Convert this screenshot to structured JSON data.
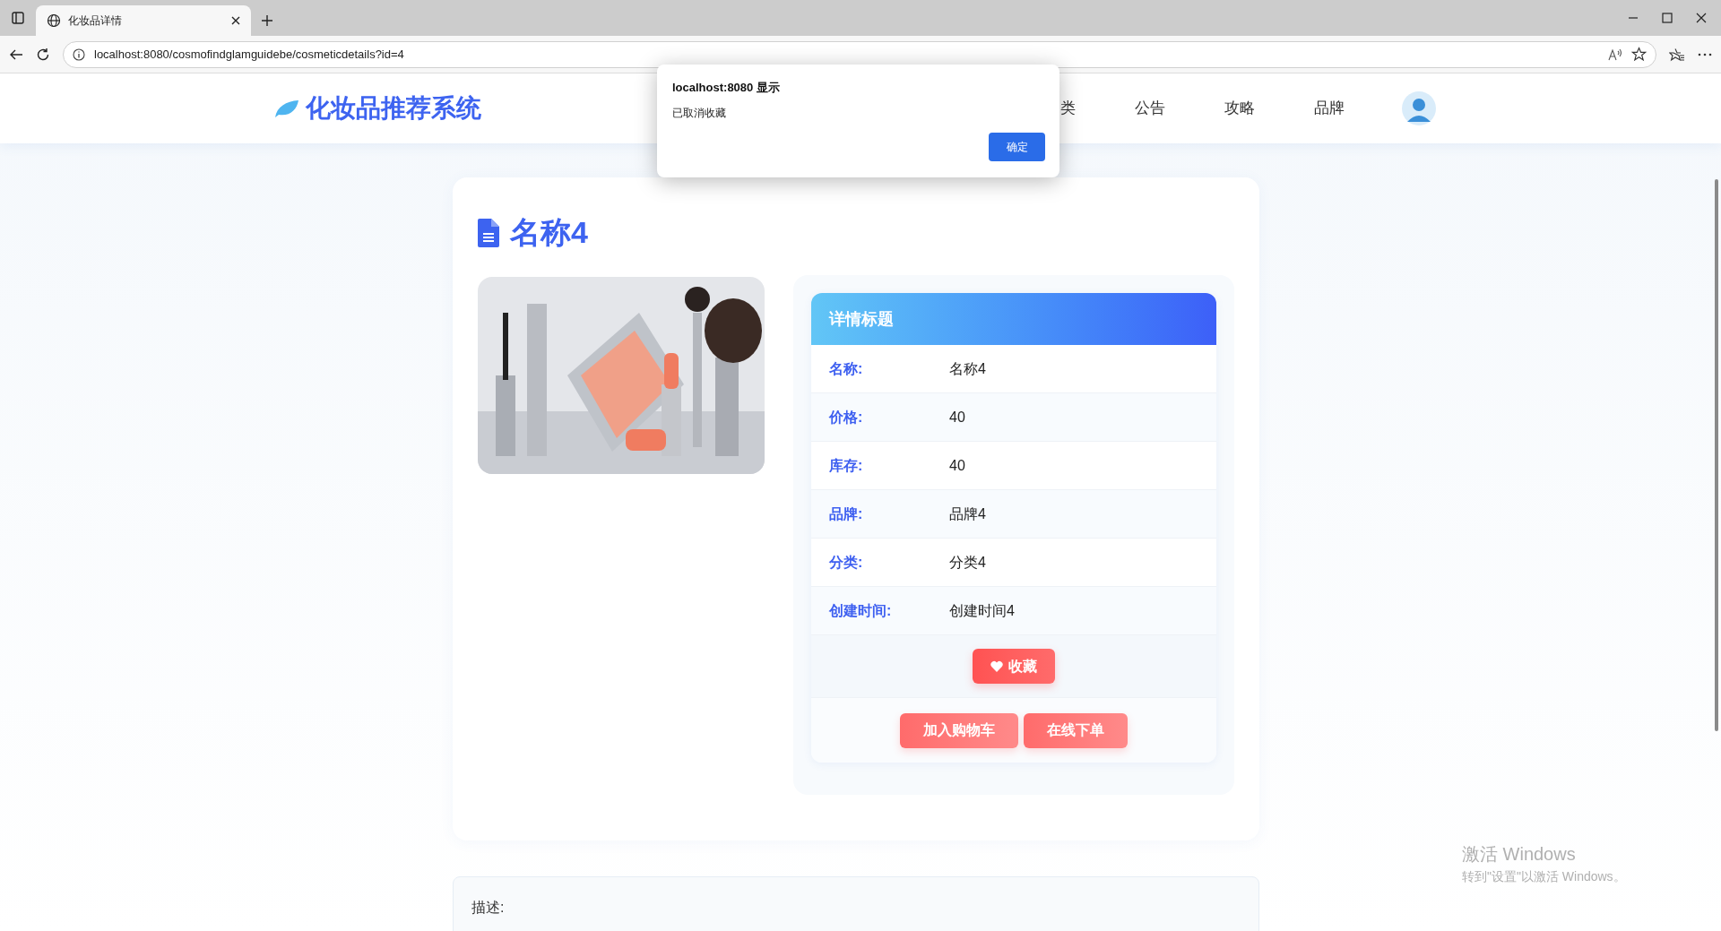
{
  "browser": {
    "tab_title": "化妆品详情",
    "url": "localhost:8080/cosmofindglamguidebe/cosmeticdetails?id=4"
  },
  "site": {
    "logo": "化妆品推荐系统",
    "nav": [
      "类",
      "公告",
      "攻略",
      "品牌"
    ]
  },
  "dialog": {
    "title": "localhost:8080 显示",
    "message": "已取消收藏",
    "button": "确定"
  },
  "product": {
    "title": "名称4",
    "panel_title": "详情标题",
    "fields": [
      {
        "label": "名称:",
        "value": "名称4"
      },
      {
        "label": "价格:",
        "value": "40"
      },
      {
        "label": "库存:",
        "value": "40"
      },
      {
        "label": "品牌:",
        "value": "品牌4"
      },
      {
        "label": "分类:",
        "value": "分类4"
      },
      {
        "label": "创建时间:",
        "value": "创建时间4"
      }
    ],
    "favorite_button": "收藏",
    "actions": [
      "加入购物车",
      "在线下单"
    ]
  },
  "description": {
    "label": "描述:"
  },
  "os_notice": {
    "title": "激活 Windows",
    "subtitle": "转到\"设置\"以激活 Windows。"
  }
}
